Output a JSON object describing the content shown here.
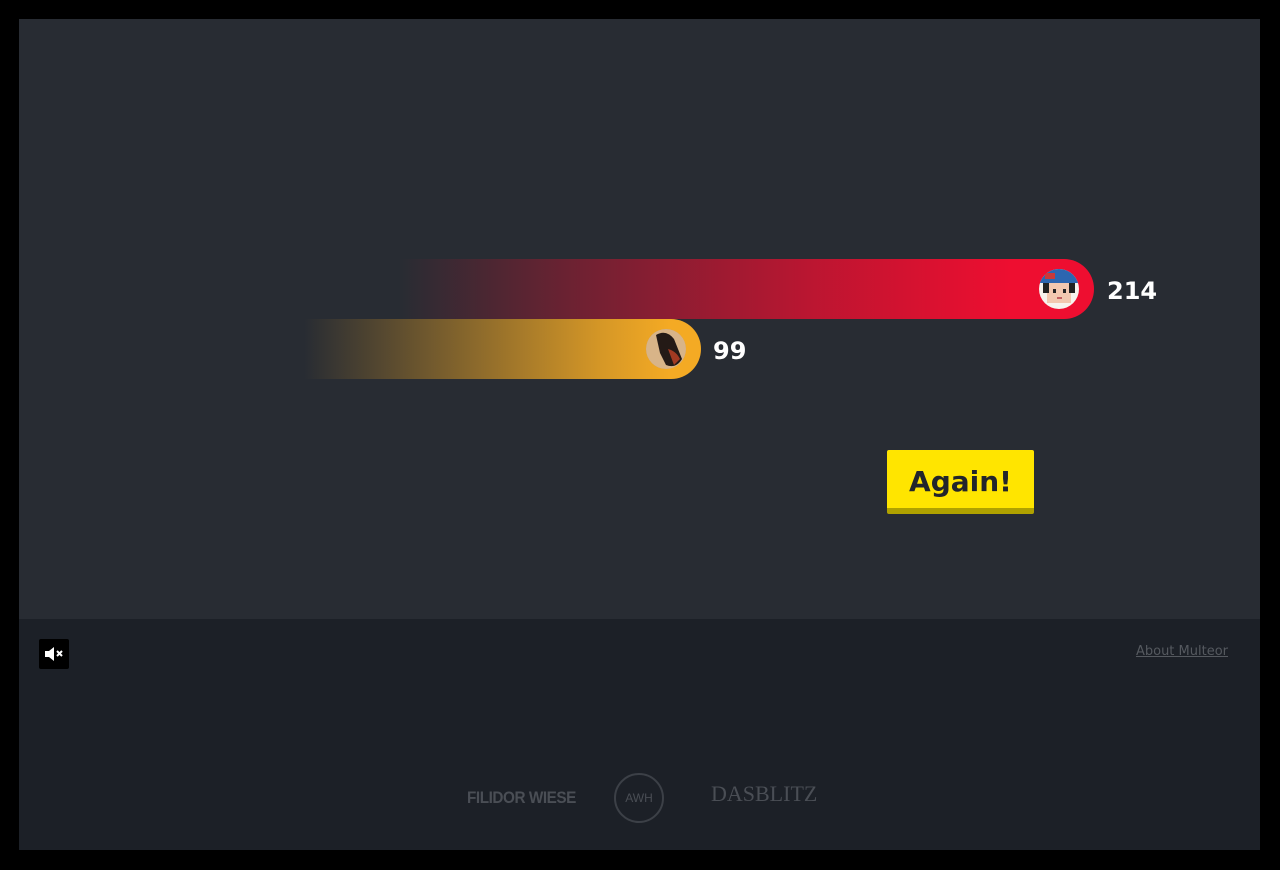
{
  "game": {
    "players": [
      {
        "name": "pixel boy",
        "score": "214",
        "color": "#ee0e30",
        "avatar_icon": "pixel-boy-avatar-icon"
      },
      {
        "name": "dark-haired",
        "score": "99",
        "color": "#f4aa24",
        "avatar_icon": "photo-avatar-icon"
      }
    ],
    "again_button": "Again!"
  },
  "footer": {
    "mute_icon": "speaker-muted-icon",
    "about_link": "About Multeor",
    "logos": {
      "filidor": "FILIDOR WIESE",
      "awh": "AWH",
      "dasblitz": "DASBLITZ"
    }
  },
  "colors": {
    "stage_bg": "#282c33",
    "footer_bg": "#1c2027",
    "button_yellow": "#ffe500"
  }
}
